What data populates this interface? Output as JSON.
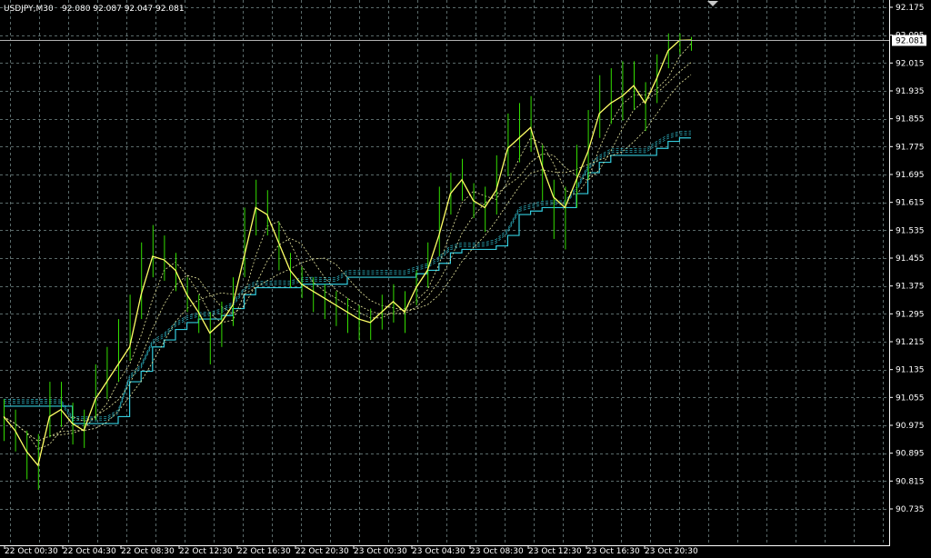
{
  "header": {
    "symbol_label": "USDJPY,M30",
    "quote_values": "92.080 92.087 92.047 92.081"
  },
  "price_badge": "92.081",
  "watermark": "",
  "colors": {
    "background": "#000000",
    "grid": "#5a6a6a",
    "axis": "#ffffff",
    "candles": "#33dd00",
    "price_line": "#ffff66",
    "ma_dashed": "#e8e8a0",
    "envelope": "#33ccdd",
    "badge_bg": "#ffffff",
    "badge_text": "#000000"
  },
  "chart_data": {
    "type": "line",
    "title": "USDJPY,M30",
    "y_ticks": [
      "92.175",
      "92.095",
      "92.015",
      "91.935",
      "91.855",
      "91.775",
      "91.695",
      "91.615",
      "91.535",
      "91.455",
      "91.375",
      "91.295",
      "91.215",
      "91.135",
      "91.055",
      "90.975",
      "90.895",
      "90.815",
      "90.735"
    ],
    "x_ticks": [
      "22 Oct 00:30",
      "22 Oct 04:30",
      "22 Oct 08:30",
      "22 Oct 12:30",
      "22 Oct 16:30",
      "22 Oct 20:30",
      "23 Oct 00:30",
      "23 Oct 04:30",
      "23 Oct 08:30",
      "23 Oct 12:30",
      "23 Oct 16:30",
      "23 Oct 20:30"
    ],
    "ylim": [
      90.735,
      92.175
    ],
    "grid": true,
    "current_price": 92.081,
    "series": [
      {
        "values": [
          91.0,
          90.96,
          90.9,
          90.86,
          91.0,
          91.02,
          90.98,
          90.96,
          91.05,
          91.1,
          91.15,
          91.2,
          91.35,
          91.46,
          91.45,
          91.42,
          91.35,
          91.3,
          91.24,
          91.27,
          91.32,
          91.46,
          91.6,
          91.58,
          91.5,
          91.42,
          91.38,
          91.36,
          91.34,
          91.32,
          91.3,
          91.28,
          91.27,
          91.3,
          91.33,
          91.3,
          91.37,
          91.42,
          91.52,
          91.64,
          91.68,
          91.62,
          91.6,
          91.65,
          91.77,
          91.8,
          91.83,
          91.72,
          91.63,
          91.6,
          91.68,
          91.76,
          91.87,
          91.9,
          91.92,
          91.95,
          91.9,
          91.97,
          92.05,
          92.08,
          92.081
        ],
        "highs": [
          91.05,
          91.02,
          90.96,
          90.95,
          91.1,
          91.1,
          91.04,
          91.02,
          91.15,
          91.2,
          91.28,
          91.35,
          91.5,
          91.55,
          91.52,
          91.47,
          91.4,
          91.35,
          91.3,
          91.33,
          91.4,
          91.6,
          91.68,
          91.65,
          91.56,
          91.47,
          91.43,
          91.4,
          91.38,
          91.36,
          91.34,
          91.32,
          91.31,
          91.35,
          91.38,
          91.36,
          91.42,
          91.5,
          91.66,
          91.7,
          91.74,
          91.67,
          91.66,
          91.75,
          91.87,
          91.9,
          91.92,
          91.78,
          91.68,
          91.66,
          91.78,
          91.88,
          91.98,
          92.0,
          92.02,
          92.02,
          91.96,
          92.04,
          92.1,
          92.1,
          92.09
        ],
        "lows": [
          90.93,
          90.9,
          90.82,
          90.79,
          90.94,
          90.97,
          90.92,
          90.91,
          90.99,
          91.05,
          91.1,
          91.16,
          91.28,
          91.4,
          91.39,
          91.36,
          91.3,
          91.24,
          91.15,
          91.2,
          91.26,
          91.4,
          91.52,
          91.52,
          91.42,
          91.37,
          91.34,
          91.3,
          91.28,
          91.26,
          91.24,
          91.22,
          91.22,
          91.25,
          91.27,
          91.24,
          91.32,
          91.37,
          91.46,
          91.58,
          91.62,
          91.57,
          91.53,
          91.58,
          91.69,
          91.73,
          91.76,
          91.62,
          91.51,
          91.48,
          91.6,
          91.68,
          91.8,
          91.84,
          91.85,
          91.88,
          91.82,
          91.9,
          92.0,
          92.04,
          92.05
        ]
      },
      {
        "values": [
          91.03,
          91.03,
          91.03,
          91.03,
          91.03,
          91.03,
          90.98,
          90.98,
          90.98,
          90.98,
          91.0,
          91.1,
          91.13,
          91.2,
          91.22,
          91.25,
          91.27,
          91.28,
          91.28,
          91.29,
          91.31,
          91.35,
          91.37,
          91.37,
          91.37,
          91.37,
          91.38,
          91.38,
          91.38,
          91.38,
          91.4,
          91.4,
          91.4,
          91.4,
          91.4,
          91.4,
          91.41,
          91.42,
          91.44,
          91.47,
          91.48,
          91.48,
          91.48,
          91.49,
          91.52,
          91.58,
          91.59,
          91.6,
          91.6,
          91.6,
          91.64,
          91.7,
          91.73,
          91.75,
          91.75,
          91.75,
          91.75,
          91.77,
          91.79,
          91.8,
          91.8
        ]
      }
    ]
  }
}
